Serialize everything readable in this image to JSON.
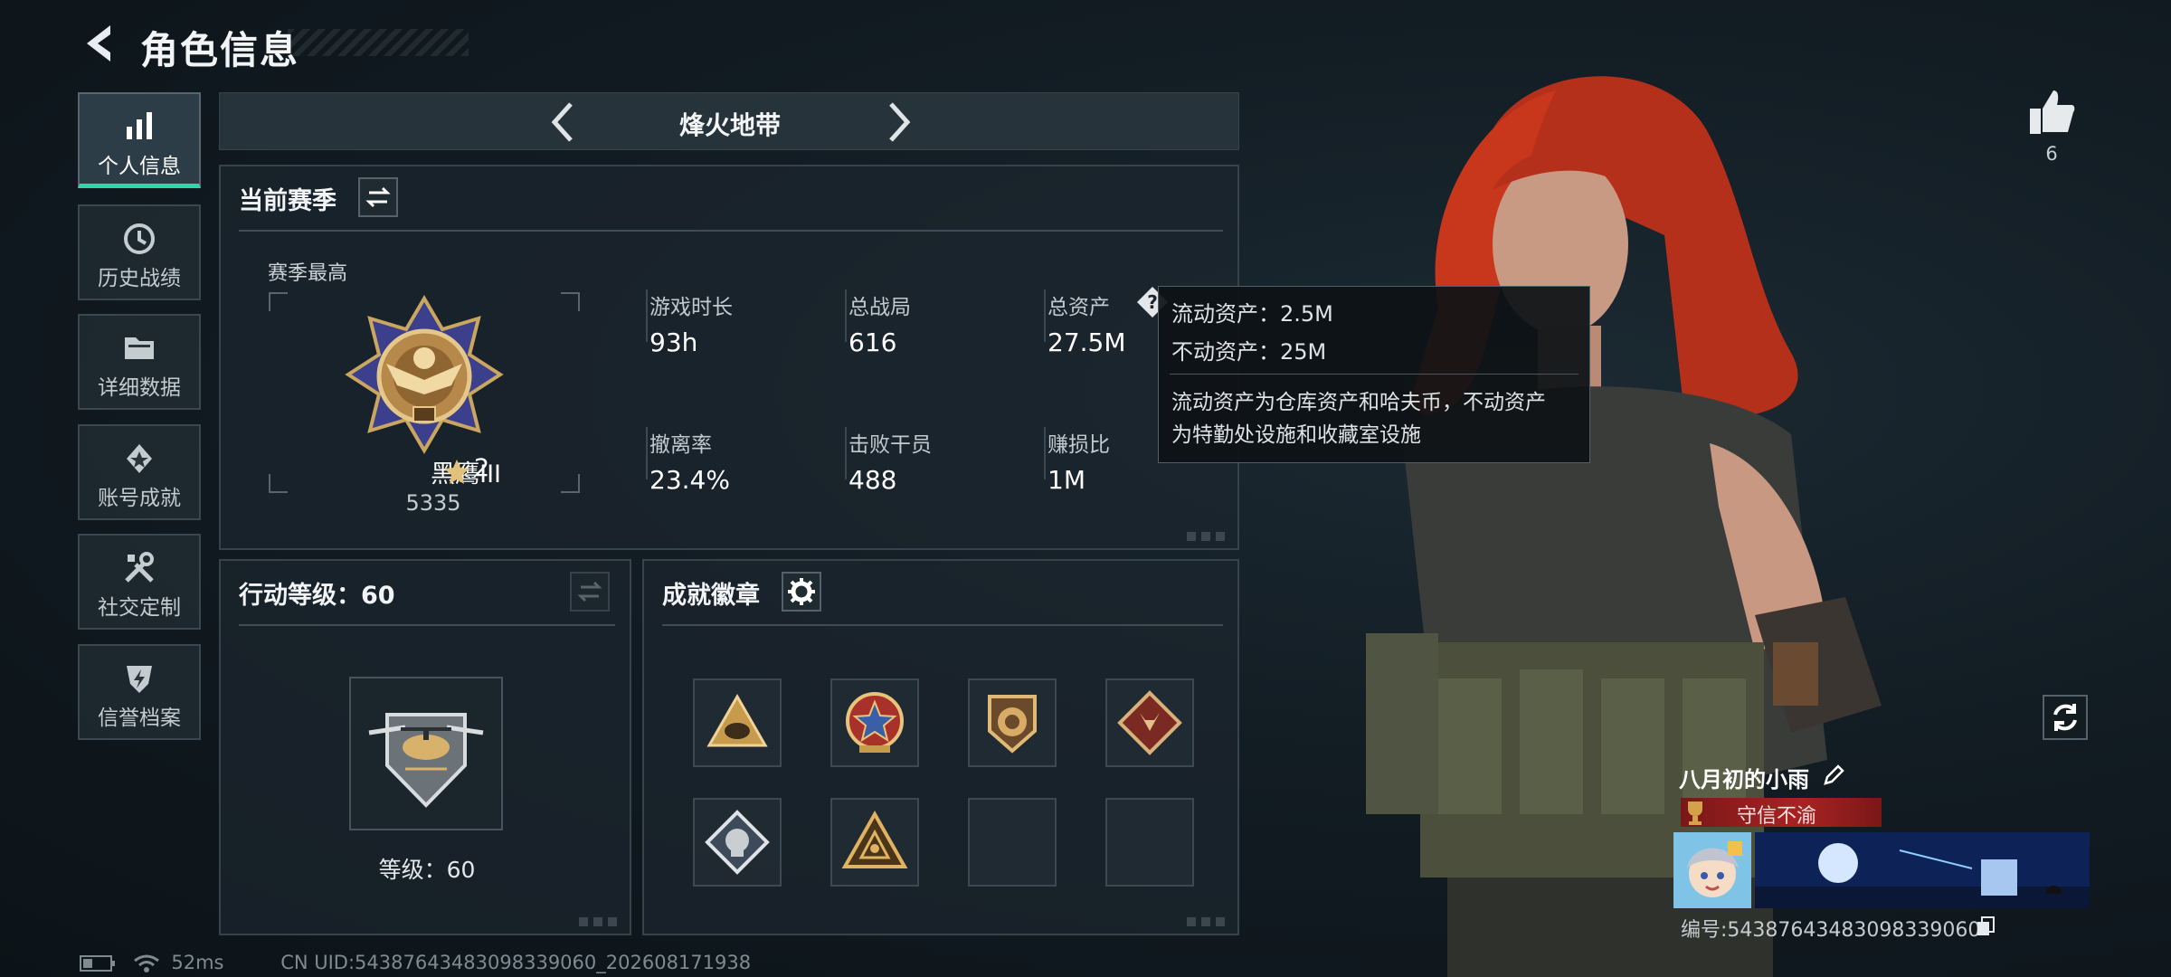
{
  "header": {
    "title": "角色信息"
  },
  "sidebar": {
    "items": [
      {
        "label": "个人信息",
        "icon": "bar-chart-icon",
        "active": true
      },
      {
        "label": "历史战绩",
        "icon": "history-icon"
      },
      {
        "label": "详细数据",
        "icon": "folder-icon"
      },
      {
        "label": "账号成就",
        "icon": "achievement-icon"
      },
      {
        "label": "社交定制",
        "icon": "tools-icon"
      },
      {
        "label": "信誉档案",
        "icon": "shield-icon"
      }
    ]
  },
  "mode": {
    "title": "烽火地带"
  },
  "season": {
    "title": "当前赛季",
    "best_label": "赛季最高",
    "rank_name": "黑鹰III",
    "rank_stars": "2",
    "rank_score": "5335",
    "stats": [
      {
        "label": "游戏时长",
        "value": "93h"
      },
      {
        "label": "总战局",
        "value": "616"
      },
      {
        "label": "总资产",
        "value": "27.5M"
      },
      {
        "label": "撤离率",
        "value": "23.4%"
      },
      {
        "label": "击败干员",
        "value": "488"
      },
      {
        "label": "赚损比",
        "value": "1M"
      }
    ]
  },
  "tooltip": {
    "line1": "流动资产：2.5M",
    "line2": "不动资产：25M",
    "desc1": "流动资产为仓库资产和哈夫币，不动资产",
    "desc2": "为特勤处设施和收藏室设施"
  },
  "action_level": {
    "title": "行动等级：60",
    "level_text": "等级：60"
  },
  "achievements": {
    "title": "成就徽章",
    "filled": 6,
    "total": 8
  },
  "player": {
    "likes": "6",
    "name": "八月初的小雨",
    "title_badge": "守信不渝",
    "uid_label": "编号:54387643483098339060"
  },
  "footer": {
    "ping": "52ms",
    "uid": "CN UID:54387643483098339060_202608171938"
  },
  "colors": {
    "accent": "#2fd6a8",
    "hair": "#c8371c",
    "badge_red": "#a82323"
  }
}
